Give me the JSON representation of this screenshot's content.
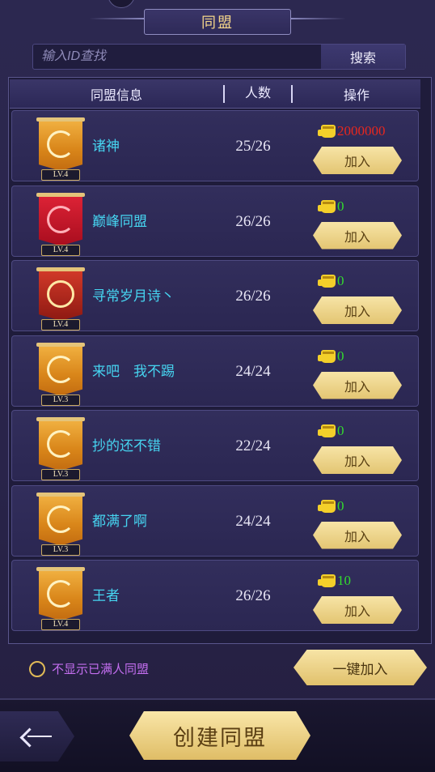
{
  "header": {
    "title": "同盟"
  },
  "search": {
    "placeholder": "输入ID查找",
    "button_label": "搜索"
  },
  "table": {
    "columns": [
      "同盟信息",
      "人数",
      "操作"
    ],
    "rows": [
      {
        "name": "诸神",
        "level": "LV.4",
        "members": "25/26",
        "power": "2000000",
        "power_color": "#e8271e",
        "join_label": "加入",
        "banner": "gold"
      },
      {
        "name": "巅峰同盟",
        "level": "LV.4",
        "members": "26/26",
        "power": "0",
        "power_color": "#33dc2e",
        "join_label": "加入",
        "banner": "red"
      },
      {
        "name": "寻常岁月诗丶",
        "level": "LV.4",
        "members": "26/26",
        "power": "0",
        "power_color": "#33dc2e",
        "join_label": "加入",
        "banner": "crest"
      },
      {
        "name": "来吧　我不踢",
        "level": "LV.3",
        "members": "24/24",
        "power": "0",
        "power_color": "#33dc2e",
        "join_label": "加入",
        "banner": "gold"
      },
      {
        "name": "抄的还不错",
        "level": "LV.3",
        "members": "22/24",
        "power": "0",
        "power_color": "#33dc2e",
        "join_label": "加入",
        "banner": "gold"
      },
      {
        "name": "都满了啊",
        "level": "LV.3",
        "members": "24/24",
        "power": "0",
        "power_color": "#33dc2e",
        "join_label": "加入",
        "banner": "gold"
      },
      {
        "name": "王者",
        "level": "LV.4",
        "members": "26/26",
        "power": "10",
        "power_color": "#33dc2e",
        "join_label": "加入",
        "banner": "gold"
      }
    ]
  },
  "footer": {
    "filter_label": "不显示已满人同盟",
    "join_all_label": "一键加入",
    "create_label": "创建同盟"
  },
  "icons": {
    "power": "fist-icon",
    "back": "back-arrow-icon"
  },
  "colors": {
    "alliance_name": "#46d4f0",
    "filter_label": "#c46ef0",
    "title": "#f4d58a"
  }
}
